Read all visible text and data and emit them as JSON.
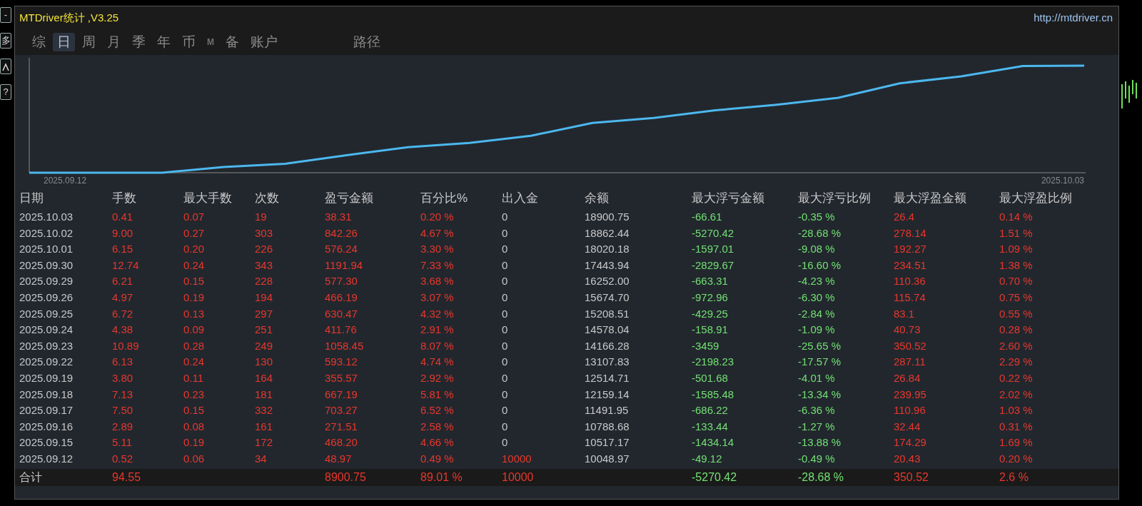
{
  "window": {
    "title": "MTDriver统计 ,V3.25",
    "link": "http://mtdriver.cn"
  },
  "side_buttons": [
    {
      "kind": "text",
      "label": "-"
    },
    {
      "kind": "text",
      "label": "多"
    },
    {
      "kind": "icon"
    },
    {
      "kind": "text",
      "label": "?"
    }
  ],
  "tabs": [
    {
      "label": "综",
      "selected": false
    },
    {
      "label": "日",
      "selected": true
    },
    {
      "label": "周",
      "selected": false
    },
    {
      "label": "月",
      "selected": false
    },
    {
      "label": "季",
      "selected": false
    },
    {
      "label": "年",
      "selected": false
    },
    {
      "label": "币",
      "selected": false
    },
    {
      "label": "M",
      "selected": false,
      "kind": "small"
    },
    {
      "label": "备",
      "selected": false
    },
    {
      "label": "账户",
      "selected": false
    }
  ],
  "path_button": "路径",
  "chart": {
    "start_label": "2025.09.12",
    "end_label": "2025.10.03"
  },
  "table": {
    "columns": [
      {
        "label": "日期",
        "color": "#c8c8c8"
      },
      {
        "label": "手数",
        "color": "#e8372c"
      },
      {
        "label": "最大手数",
        "color": "#e8372c"
      },
      {
        "label": "次数",
        "color": "#e8372c"
      },
      {
        "label": "盈亏金额",
        "color": "#e8372c"
      },
      {
        "label": "百分比%",
        "color": "#e8372c"
      },
      {
        "label": "出入金",
        "color": "#c8c8c8"
      },
      {
        "label": "余额",
        "color": "#c8c8c8"
      },
      {
        "label": "最大浮亏金额",
        "color": "#72e072"
      },
      {
        "label": "最大浮亏比例",
        "color": "#72e072"
      },
      {
        "label": "最大浮盈金额",
        "color": "#e8372c"
      },
      {
        "label": "最大浮盈比例",
        "color": "#e8372c"
      }
    ],
    "rows": [
      {
        "cells": [
          "2025.10.03",
          "0.41",
          "0.07",
          "19",
          "38.31",
          "0.20 %",
          "0",
          "18900.75",
          "-66.61",
          "-0.35 %",
          "26.4",
          "0.14 %"
        ]
      },
      {
        "cells": [
          "2025.10.02",
          "9.00",
          "0.27",
          "303",
          "842.26",
          "4.67 %",
          "0",
          "18862.44",
          "-5270.42",
          "-28.68 %",
          "278.14",
          "1.51 %"
        ]
      },
      {
        "cells": [
          "2025.10.01",
          "6.15",
          "0.20",
          "226",
          "576.24",
          "3.30 %",
          "0",
          "18020.18",
          "-1597.01",
          "-9.08 %",
          "192.27",
          "1.09 %"
        ]
      },
      {
        "cells": [
          "2025.09.30",
          "12.74",
          "0.24",
          "343",
          "1191.94",
          "7.33 %",
          "0",
          "17443.94",
          "-2829.67",
          "-16.60 %",
          "234.51",
          "1.38 %"
        ]
      },
      {
        "cells": [
          "2025.09.29",
          "6.21",
          "0.15",
          "228",
          "577.30",
          "3.68 %",
          "0",
          "16252.00",
          "-663.31",
          "-4.23 %",
          "110.36",
          "0.70 %"
        ]
      },
      {
        "cells": [
          "2025.09.26",
          "4.97",
          "0.19",
          "194",
          "466.19",
          "3.07 %",
          "0",
          "15674.70",
          "-972.96",
          "-6.30 %",
          "115.74",
          "0.75 %"
        ]
      },
      {
        "cells": [
          "2025.09.25",
          "6.72",
          "0.13",
          "297",
          "630.47",
          "4.32 %",
          "0",
          "15208.51",
          "-429.25",
          "-2.84 %",
          "83.1",
          "0.55 %"
        ]
      },
      {
        "cells": [
          "2025.09.24",
          "4.38",
          "0.09",
          "251",
          "411.76",
          "2.91 %",
          "0",
          "14578.04",
          "-158.91",
          "-1.09 %",
          "40.73",
          "0.28 %"
        ]
      },
      {
        "cells": [
          "2025.09.23",
          "10.89",
          "0.28",
          "249",
          "1058.45",
          "8.07 %",
          "0",
          "14166.28",
          "-3459",
          "-25.65 %",
          "350.52",
          "2.60 %"
        ]
      },
      {
        "cells": [
          "2025.09.22",
          "6.13",
          "0.24",
          "130",
          "593.12",
          "4.74 %",
          "0",
          "13107.83",
          "-2198.23",
          "-17.57 %",
          "287.11",
          "2.29 %"
        ]
      },
      {
        "cells": [
          "2025.09.19",
          "3.80",
          "0.11",
          "164",
          "355.57",
          "2.92 %",
          "0",
          "12514.71",
          "-501.68",
          "-4.01 %",
          "26.84",
          "0.22 %"
        ]
      },
      {
        "cells": [
          "2025.09.18",
          "7.13",
          "0.23",
          "181",
          "667.19",
          "5.81 %",
          "0",
          "12159.14",
          "-1585.48",
          "-13.34 %",
          "239.95",
          "2.02 %"
        ]
      },
      {
        "cells": [
          "2025.09.17",
          "7.50",
          "0.15",
          "332",
          "703.27",
          "6.52 %",
          "0",
          "11491.95",
          "-686.22",
          "-6.36 %",
          "110.96",
          "1.03 %"
        ]
      },
      {
        "cells": [
          "2025.09.16",
          "2.89",
          "0.08",
          "161",
          "271.51",
          "2.58 %",
          "0",
          "10788.68",
          "-133.44",
          "-1.27 %",
          "32.44",
          "0.31 %"
        ]
      },
      {
        "cells": [
          "2025.09.15",
          "5.11",
          "0.19",
          "172",
          "468.20",
          "4.66 %",
          "0",
          "10517.17",
          "-1434.14",
          "-13.88 %",
          "174.29",
          "1.69 %"
        ]
      },
      {
        "cells": [
          "2025.09.12",
          "0.52",
          "0.06",
          "34",
          "48.97",
          "0.49 %",
          {
            "text": "10000",
            "color": "#e8372c"
          },
          "10048.97",
          "-49.12",
          "-0.49 %",
          "20.43",
          "0.20 %"
        ]
      }
    ],
    "total": {
      "cells": [
        "合计",
        "94.55",
        null,
        null,
        "8900.75",
        "89.01 %",
        {
          "text": "10000",
          "color": "#e8372c"
        },
        null,
        "-5270.42",
        "-28.68 %",
        "350.52",
        "2.6 %"
      ]
    }
  }
}
